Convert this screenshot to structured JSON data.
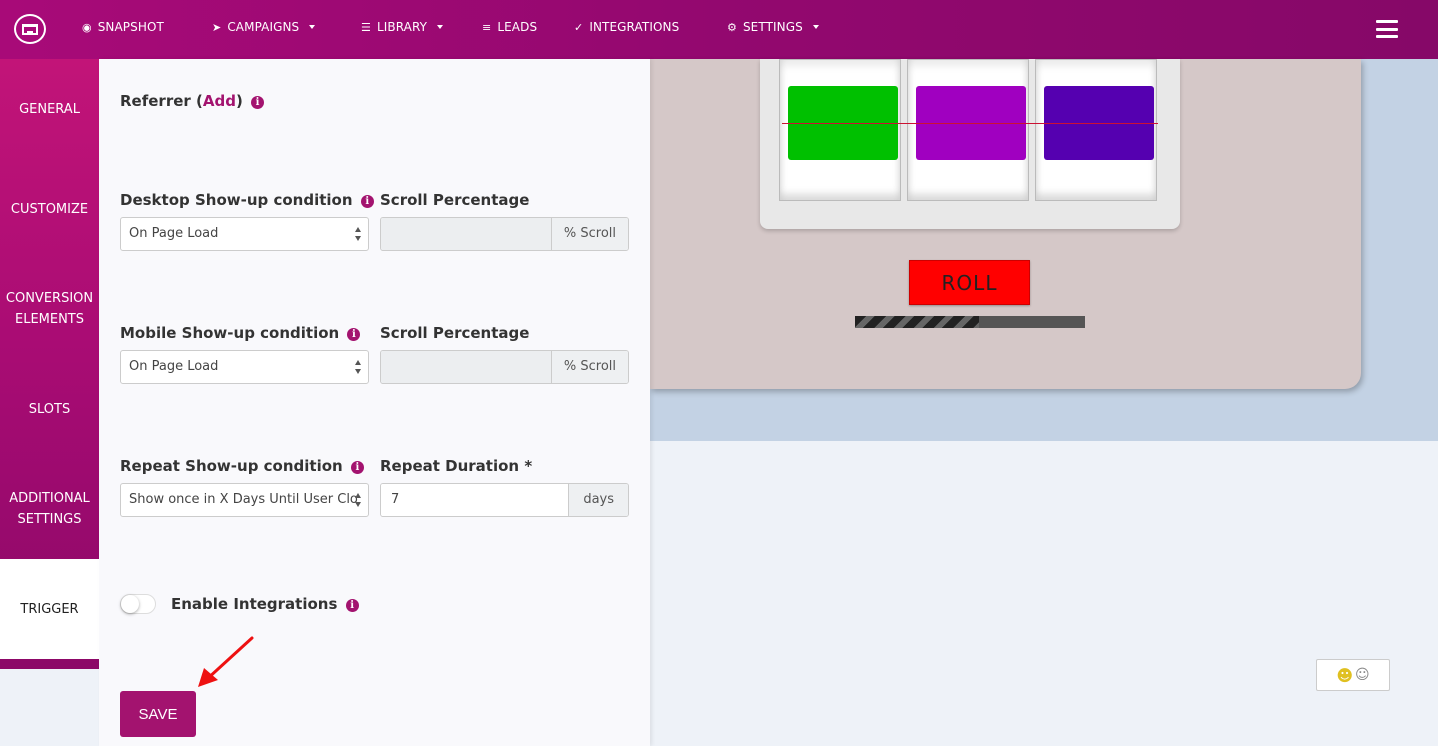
{
  "nav": {
    "items": [
      {
        "label": "SNAPSHOT",
        "icon": "dashboard-icon",
        "has_caret": false
      },
      {
        "label": "CAMPAIGNS",
        "icon": "paper-plane-icon",
        "has_caret": true
      },
      {
        "label": "LIBRARY",
        "icon": "list-icon",
        "has_caret": true
      },
      {
        "label": "LEADS",
        "icon": "list-bullets-icon",
        "has_caret": false
      },
      {
        "label": "INTEGRATIONS",
        "icon": "plug-icon",
        "has_caret": false
      },
      {
        "label": "SETTINGS",
        "icon": "cogs-icon",
        "has_caret": true
      }
    ]
  },
  "sidebar": {
    "items": [
      {
        "label": "GENERAL"
      },
      {
        "label": "CUSTOMIZE"
      },
      {
        "label_line1": "CONVERSION",
        "label_line2": "ELEMENTS"
      },
      {
        "label": "SLOTS"
      },
      {
        "label_line1": "ADDITIONAL",
        "label_line2": "SETTINGS"
      },
      {
        "label": "TRIGGER",
        "active": true
      }
    ]
  },
  "panel": {
    "referrer": {
      "prefix": "Referrer (",
      "link": "Add",
      "suffix": ")"
    },
    "desktop": {
      "condition_label": "Desktop Show-up condition",
      "condition_value": "On Page Load",
      "scroll_label": "Scroll Percentage",
      "scroll_value": "",
      "scroll_addon": "% Scroll"
    },
    "mobile": {
      "condition_label": "Mobile Show-up condition",
      "condition_value": "On Page Load",
      "scroll_label": "Scroll Percentage",
      "scroll_value": "",
      "scroll_addon": "% Scroll"
    },
    "repeat": {
      "condition_label": "Repeat Show-up condition",
      "condition_value": "Show once in X Days Until User Clo",
      "duration_label": "Repeat Duration *",
      "duration_value": "7",
      "duration_addon": "days"
    },
    "integrations": {
      "label": "Enable Integrations",
      "enabled": false
    },
    "save_label": "SAVE"
  },
  "preview": {
    "roll_label": "ROLL",
    "reel_colors": [
      "#00c000",
      "#a000c0",
      "#5500b0"
    ],
    "progress_fraction": 0.54
  },
  "info_glyph": "i",
  "colors": {
    "brand": "#a3136f",
    "nav_bg": "#93086f",
    "roll_button": "#ff0000"
  }
}
